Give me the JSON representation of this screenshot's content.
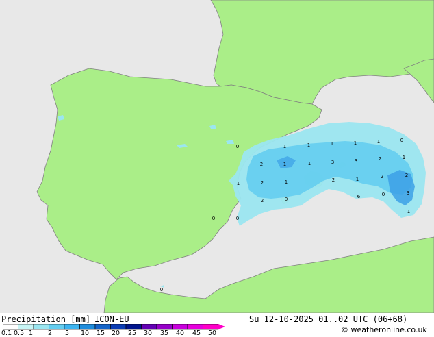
{
  "title": "Precipitation [mm]",
  "model": "ICON-EU",
  "valid_time": "Su 12-10-2025 01..02 UTC (06+68)",
  "credit": "© weatheronline.co.uk",
  "colors": {
    "sea": "#e8e8e8",
    "land": "#aaee88",
    "rain_light": "#9be6f0",
    "rain_mid": "#64cdf0",
    "rain_heavy": "#3ca0e6"
  },
  "legend": {
    "ticks": [
      "0.1",
      "0.5",
      "1",
      "2",
      "5",
      "10",
      "15",
      "20",
      "25",
      "30",
      "35",
      "40",
      "45",
      "50"
    ],
    "colors": [
      "#ffffff",
      "#c8f5f5",
      "#9be6f0",
      "#64cdf0",
      "#3cb4f0",
      "#1e8cdc",
      "#1464c8",
      "#0a3cb4",
      "#00148c",
      "#6400b4",
      "#9600c8",
      "#c800dc",
      "#e600dc",
      "#ff00c8"
    ]
  },
  "values": [
    "0",
    "1",
    "1",
    "1",
    "1",
    "1",
    "0",
    "2",
    "1",
    "1",
    "3",
    "3",
    "2",
    "1",
    "1",
    "2",
    "1",
    "2",
    "1",
    "2",
    "2",
    "2",
    "0",
    "6",
    "0",
    "3",
    "0",
    "0",
    "1",
    "0"
  ]
}
